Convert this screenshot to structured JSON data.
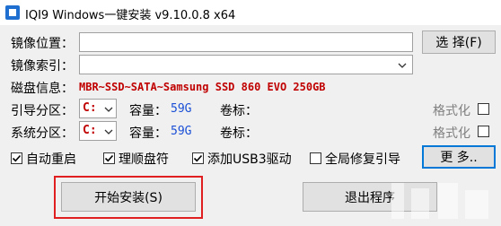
{
  "window": {
    "title": "IQI9 Windows一键安装 v9.10.0.8 x64"
  },
  "form": {
    "image_path_label": "镜像位置：",
    "image_path_value": "",
    "select_button": "选 择(F)",
    "image_index_label": "镜像索引：",
    "image_index_value": "",
    "disk_info_label": "磁盘信息：",
    "disk_info_value": "MBR~SSD~SATA~Samsung SSD 860 EVO 250GB",
    "boot_partition_label": "引导分区：",
    "boot_partition_value": "C:",
    "boot_capacity_label": "容量：",
    "boot_capacity_value": "59G",
    "boot_volume_label": "卷标：",
    "boot_format": "格式化",
    "system_partition_label": "系统分区：",
    "system_partition_value": "C:",
    "system_capacity_label": "容量：",
    "system_capacity_value": "59G",
    "system_volume_label": "卷标：",
    "system_format": "格式化"
  },
  "options": [
    {
      "label": "自动重启",
      "checked": true
    },
    {
      "label": "理顺盘符",
      "checked": true
    },
    {
      "label": "添加USB3驱动",
      "checked": true
    },
    {
      "label": "全局修复引导",
      "checked": false
    }
  ],
  "more_button": "更 多..",
  "start_button": "开始安装(S)",
  "exit_button": "退出程序",
  "colors": {
    "accent": "#0078d7",
    "highlight": "#e02020",
    "disk_info": "#c00000",
    "capacity": "#1a4fd6"
  }
}
